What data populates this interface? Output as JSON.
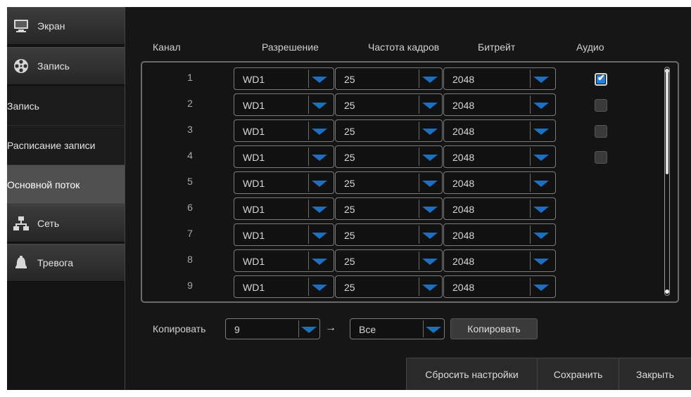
{
  "sidebar": {
    "items": [
      {
        "label": "Экран",
        "icon": "monitor-icon"
      },
      {
        "label": "Запись",
        "icon": "film-reel-icon"
      },
      {
        "label": "Запись"
      },
      {
        "label": "Расписание записи"
      },
      {
        "label": "Основной поток",
        "active": true
      },
      {
        "label": "Сеть",
        "icon": "network-icon"
      },
      {
        "label": "Тревога",
        "icon": "alarm-bell-icon"
      }
    ]
  },
  "table": {
    "headers": {
      "channel": "Канал",
      "resolution": "Разрешение",
      "fps": "Частота кадров",
      "bitrate": "Битрейт",
      "audio": "Аудио"
    },
    "rows": [
      {
        "ch": "1",
        "res": "WD1",
        "fps": "25",
        "br": "2048",
        "audio": "checked"
      },
      {
        "ch": "2",
        "res": "WD1",
        "fps": "25",
        "br": "2048",
        "audio": "unchecked"
      },
      {
        "ch": "3",
        "res": "WD1",
        "fps": "25",
        "br": "2048",
        "audio": "unchecked"
      },
      {
        "ch": "4",
        "res": "WD1",
        "fps": "25",
        "br": "2048",
        "audio": "unchecked"
      },
      {
        "ch": "5",
        "res": "WD1",
        "fps": "25",
        "br": "2048",
        "audio": "none"
      },
      {
        "ch": "6",
        "res": "WD1",
        "fps": "25",
        "br": "2048",
        "audio": "none"
      },
      {
        "ch": "7",
        "res": "WD1",
        "fps": "25",
        "br": "2048",
        "audio": "none"
      },
      {
        "ch": "8",
        "res": "WD1",
        "fps": "25",
        "br": "2048",
        "audio": "none"
      },
      {
        "ch": "9",
        "res": "WD1",
        "fps": "25",
        "br": "2048",
        "audio": "none"
      }
    ]
  },
  "copy": {
    "label": "Копировать",
    "from": "9",
    "arrow": "→",
    "to": "Все",
    "button": "Копировать"
  },
  "buttons": {
    "reset": "Сбросить настройки",
    "save": "Сохранить",
    "close": "Закрыть"
  },
  "colors": {
    "accent": "#1d6fc2",
    "active_menu": "#505050",
    "checkbox_on": "#2a7fd6"
  }
}
